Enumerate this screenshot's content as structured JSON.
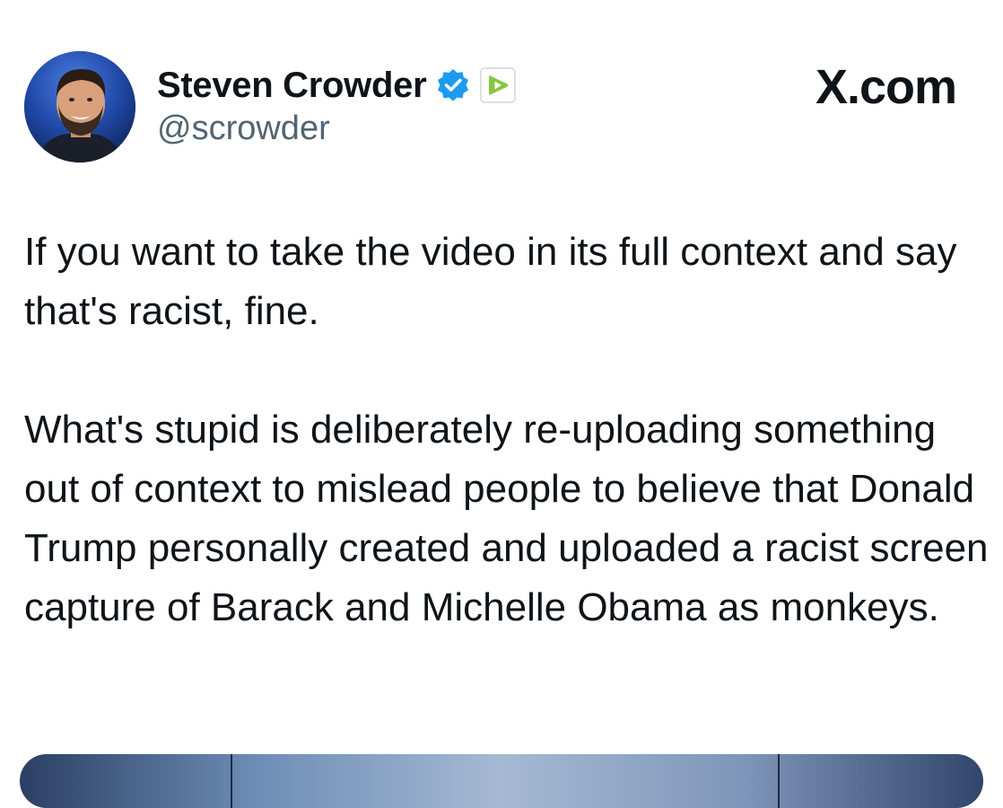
{
  "author": {
    "display_name": "Steven Crowder",
    "handle": "@scrowder",
    "avatar_icon": "profile-photo",
    "verified_icon": "blue-check-badge-icon",
    "affiliate_icon": "rumble-logo-icon"
  },
  "site_label": "X.com",
  "tweet": {
    "paragraphs": [
      "If you want to take the video in its full context and say that's racist, fine.",
      "What's stupid is deliberately re-uploading something out of context to mislead people to believe that Donald Trump personally created and uploaded a racist screen capture of Barack and Michelle Obama as monkeys."
    ]
  },
  "colors": {
    "text": "#0f1419",
    "secondary_text": "#536471",
    "verified_blue": "#1d9bf0",
    "rumble_green": "#85c742"
  }
}
